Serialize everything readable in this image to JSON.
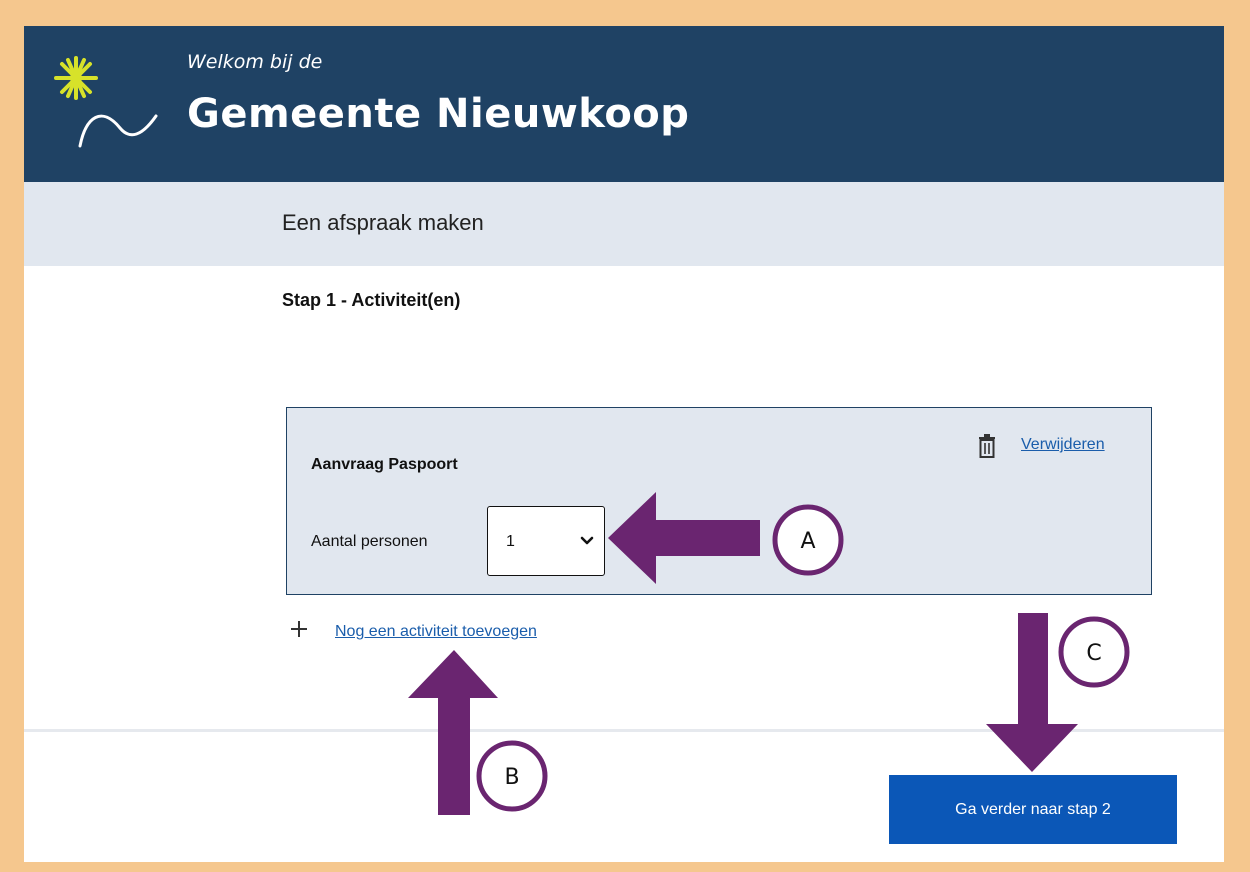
{
  "header": {
    "welcome": "Welkom bij de",
    "municipality": "Gemeente Nieuwkoop"
  },
  "subbar": {
    "title": "Een afspraak maken"
  },
  "step": {
    "title": "Stap 1 - Activiteit(en)"
  },
  "activity": {
    "title": "Aanvraag Paspoort",
    "delete_label": "Verwijderen",
    "persons_label": "Aantal personen",
    "persons_value": "1"
  },
  "add_activity_label": "Nog een activiteit toevoegen",
  "next_button_label": "Ga verder naar stap 2",
  "annotations": {
    "a": "A",
    "b": "B",
    "c": "C"
  },
  "colors": {
    "frame": "#f5c78e",
    "header": "#1f4264",
    "subbar": "#e1e7ef",
    "link": "#1a5dab",
    "button": "#0b57b7",
    "arrow": "#6a2570"
  },
  "icons": {
    "logo": "sun-swoosh-logo-icon",
    "delete": "trash-icon",
    "add": "plus-icon",
    "select": "chevron-down-icon"
  }
}
